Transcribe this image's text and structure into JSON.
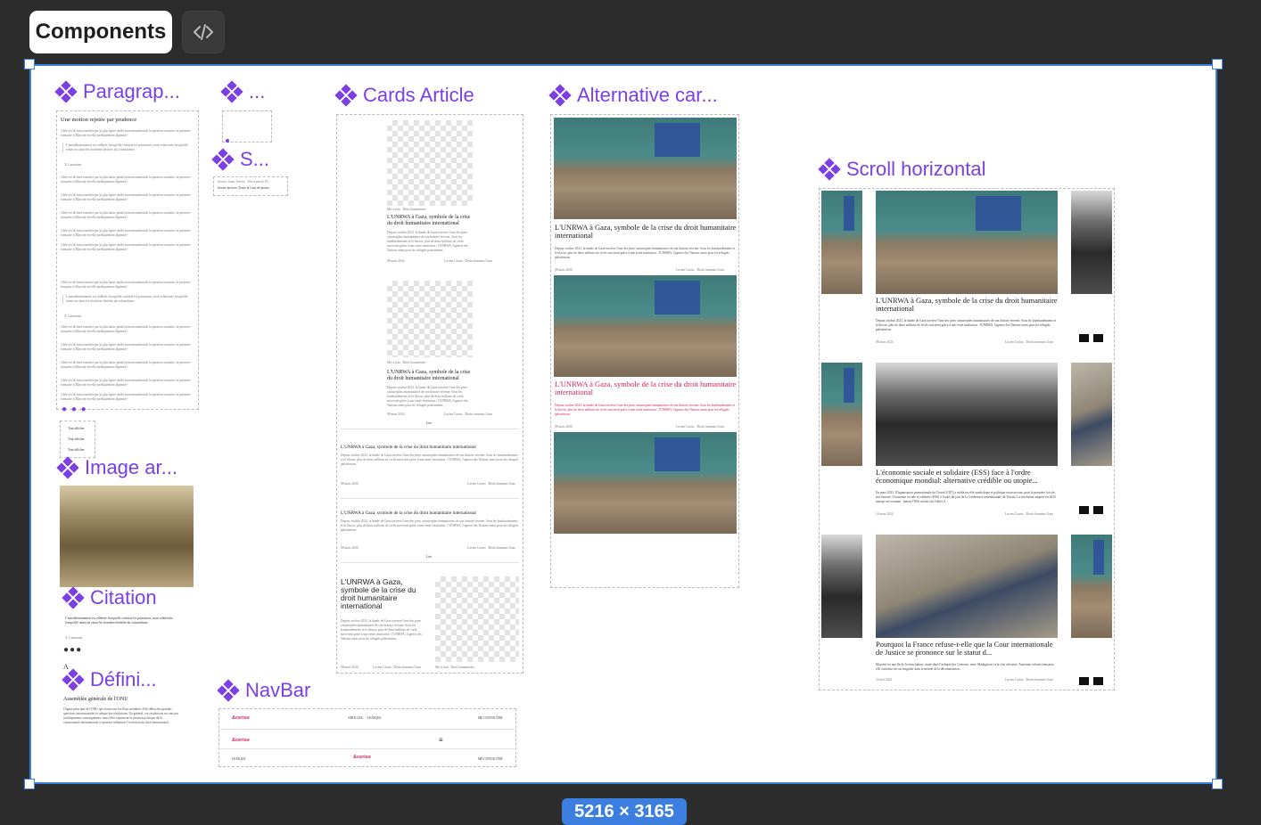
{
  "toolbar": {
    "tab_label": "Components",
    "code_icon": "code-icon"
  },
  "frame": {
    "size_label": "5216 × 3165",
    "accent": "#3d7fe0",
    "component_color": "#7b3fe4"
  },
  "labels": {
    "paragraph": "Paragrap...",
    "dots": "...",
    "s": "S...",
    "cards": "Cards Article",
    "alt": "Alternative car...",
    "scroll": "Scroll horizontal",
    "image": "Image ar...",
    "citation": "Citation",
    "definition": "Défini...",
    "navbar": "NavBar"
  },
  "paragraph": {
    "heading": "Une motion rejetée par prudence",
    "body": "Cible est de faire trancher par la plus haute juridiction internationale la question suivante: la présence française à Mayotte est-elle juridiquement légitime?",
    "quote": "L'autodétermination est célébrée lorsqu'elle conforte les puissances, mais relativisée lorsqu'elle remet en cause les frontières héritées du colonialisme.",
    "quote_author": "X. Lamartine",
    "show_more": [
      "Tout afficher",
      "Tout afficher",
      "Tout afficher"
    ]
  },
  "s_block": {
    "line1": "Justice, Gaza, Unrwa · Mis à jour le 10",
    "line2": "Justice incisive, Toute la Cour de justice"
  },
  "article": {
    "title": "L'UNRWA à Gaza, symbole de la crise du droit humanitaire international",
    "title_short": "L'UNRWA à Gaza, symbole de la crise du droit humanitaire international",
    "excerpt": "Depuis octobre 2023, la bande de Gaza traverse l'une des pires catastrophes humanitaires de son histoire récente. Sous les bombardements et le blocus, plus de deux millions de civils survivent grâce à une seule institution : l'UNRWA, l'agence des Nations unies pour les réfugiés palestiniens.",
    "date": "08 mars 2024",
    "tags": "Lucien Cactus · Droits humains Gaza",
    "meta": "Mis à jour · Droit humanitaire",
    "more": "Lire"
  },
  "scroll": {
    "card2_title": "L'économie sociale et solidaire (ESS) face à l'ordre économique mondial: alternative crédible ou utopie...",
    "card2_excerpt": "En mars 2023, l'Organisation internationale du Travail (OIT) a ratifié un rôle symbolique et politique en inscrivant, pour la première fois de son histoire, l'économie sociale et solidaire (ESS) à l'ordre du jour de la Conférence internationale du Travail. La résolution adoptée en 2023 marque un tournant : jamais l'ESS n'avait fait l'objet d'...",
    "card2_date": "14 mars 2024",
    "card3_title": "Pourquoi la France refuse-t-elle que la Cour internationale de Justice se prononce sur le statut d...",
    "card3_excerpt": "Mayotte est une île de l'océan Indien, située dans l'archipel des Comores, entre Madagascar et la côte africaine. Ancienne colonie française, elle constitue un cas singulier dans le monde de la décolonisation.",
    "card3_date": "10 mai 2024"
  },
  "citation": {
    "text": "L'autodétermination est célébrée lorsqu'elle conforte les puissances, mais relativisée lorsqu'elle remet en cause les frontières héritées du colonialisme.",
    "author": "X. Lamartine",
    "marker": "A"
  },
  "definition": {
    "term": "Assemblée générale de l'ONU",
    "text": "Organe principal de l'ONU qui réunit tous les États membres. Elle débat des grandes questions internationales et adopte des résolutions. En général, ces résolutions ne sont pas juridiquement contraignantes, mais elles expriment la position politique de la communauté internationale et peuvent influencer l'évolution du droit international."
  },
  "navbar": {
    "logo": "&cerise",
    "links": [
      "ARTICLES",
      "LEXIQUE"
    ],
    "contact": "ME CONTACTER",
    "menu_icon": "≡",
    "lexique": "LEXIQUE",
    "logo_color": "#d3215e"
  }
}
